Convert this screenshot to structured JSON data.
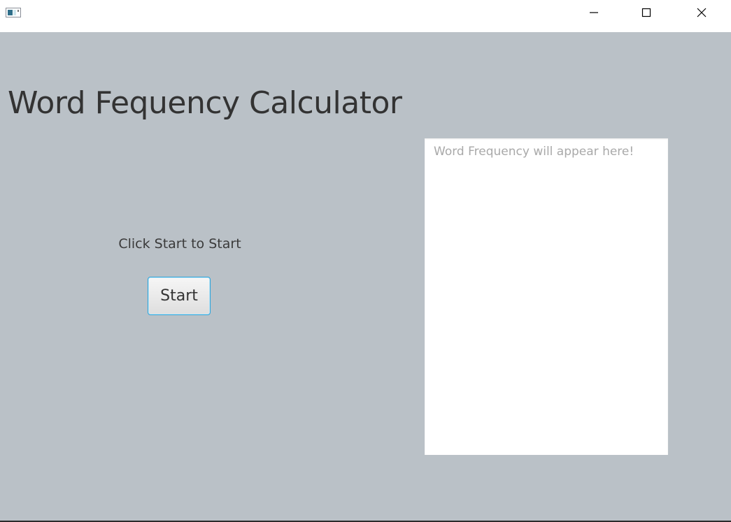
{
  "window": {
    "title": "",
    "icons": {
      "app": "app-window-icon",
      "minimize": "minimize-icon",
      "maximize": "maximize-icon",
      "close": "close-icon"
    }
  },
  "main": {
    "heading": "Word Fequency Calculator",
    "status_text": "Click Start to Start",
    "start_label": "Start",
    "output": {
      "value": "",
      "placeholder": "Word Frequency will appear here!"
    }
  },
  "colors": {
    "background": "#bac1c7",
    "button_focus_border": "#2aa6de",
    "output_background": "#ffffff",
    "placeholder_text": "#a9a9a9"
  }
}
